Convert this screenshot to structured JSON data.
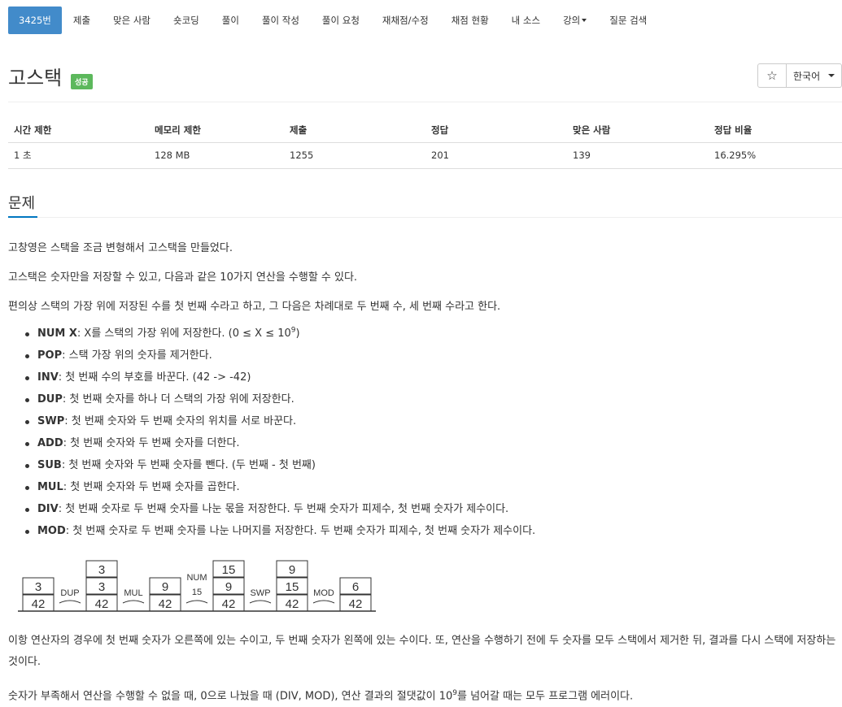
{
  "nav": {
    "tabs": [
      {
        "label": "3425번",
        "active": true
      },
      {
        "label": "제출"
      },
      {
        "label": "맞은 사람"
      },
      {
        "label": "숏코딩"
      },
      {
        "label": "풀이"
      },
      {
        "label": "풀이 작성"
      },
      {
        "label": "풀이 요청"
      },
      {
        "label": "재채점/수정"
      },
      {
        "label": "채점 현황"
      },
      {
        "label": "내 소스"
      },
      {
        "label": "강의"
      },
      {
        "label": "질문 검색"
      }
    ]
  },
  "problem": {
    "title": "고스택",
    "badge": "성공",
    "star": "☆",
    "language": "한국어"
  },
  "info": {
    "headers": [
      "시간 제한",
      "메모리 제한",
      "제출",
      "정답",
      "맞은 사람",
      "정답 비율"
    ],
    "values": [
      "1 초",
      "128 MB",
      "1255",
      "201",
      "139",
      "16.295%"
    ]
  },
  "section": {
    "title": "문제"
  },
  "body": {
    "p1": "고창영은 스택을 조금 변형해서 고스택을 만들었다.",
    "p2": "고스택은 숫자만을 저장할 수 있고, 다음과 같은 10가지 연산을 수행할 수 있다.",
    "p3": "편의상 스택의 가장 위에 저장된 수를 첫 번째 수라고 하고, 그 다음은 차례대로 두 번째 수, 세 번째 수라고 한다.",
    "ops": [
      {
        "name": "NUM X",
        "desc": ": X를 스택의 가장 위에 저장한다. (0 ≤ X ≤ 10",
        "sup": "9",
        "tail": ")"
      },
      {
        "name": "POP",
        "desc": ": 스택 가장 위의 숫자를 제거한다."
      },
      {
        "name": "INV",
        "desc": ": 첫 번째 수의 부호를 바꾼다. (42 -> -42)"
      },
      {
        "name": "DUP",
        "desc": ": 첫 번째 숫자를 하나 더 스택의 가장 위에 저장한다."
      },
      {
        "name": "SWP",
        "desc": ": 첫 번째 숫자와 두 번째 숫자의 위치를 서로 바꾼다."
      },
      {
        "name": "ADD",
        "desc": ": 첫 번째 숫자와 두 번째 숫자를 더한다."
      },
      {
        "name": "SUB",
        "desc": ": 첫 번째 숫자와 두 번째 숫자를 뺀다. (두 번째 - 첫 번째)"
      },
      {
        "name": "MUL",
        "desc": ": 첫 번째 숫자와 두 번째 숫자를 곱한다."
      },
      {
        "name": "DIV",
        "desc": ": 첫 번째 숫자로 두 번째 숫자를 나눈 몫을 저장한다. 두 번째 숫자가 피제수, 첫 번째 숫자가 제수이다."
      },
      {
        "name": "MOD",
        "desc": ": 첫 번째 숫자로 두 번째 숫자를 나눈 나머지를 저장한다. 두 번째 숫자가 피제수, 첫 번째 숫자가 제수이다."
      }
    ],
    "p4": "이항 연산자의 경우에 첫 번째 숫자가 오른쪽에 있는 수이고, 두 번째 숫자가 왼쪽에 있는 수이다. 또, 연산을 수행하기 전에 두 숫자를 모두 스택에서 제거한 뒤, 결과를 다시 스택에 저장하는 것이다.",
    "p5_pre": "숫자가 부족해서 연산을 수행할 수 없을 때, 0으로 나눴을 때 (DIV, MOD), 연산 결과의 절댓값이 10",
    "p5_sup": "9",
    "p5_post": "를 넘어갈 때는 모두 프로그램 에러이다."
  },
  "diagram": {
    "stacks": [
      [
        "3",
        "42"
      ],
      [
        "3",
        "3",
        "42"
      ],
      [
        "9",
        "42"
      ],
      [
        "15",
        "9",
        "42"
      ],
      [
        "9",
        "15",
        "42"
      ],
      [
        "6",
        "42"
      ]
    ],
    "ops": [
      "DUP",
      "MUL",
      "NUM\n15",
      "SWP",
      "MOD"
    ]
  }
}
